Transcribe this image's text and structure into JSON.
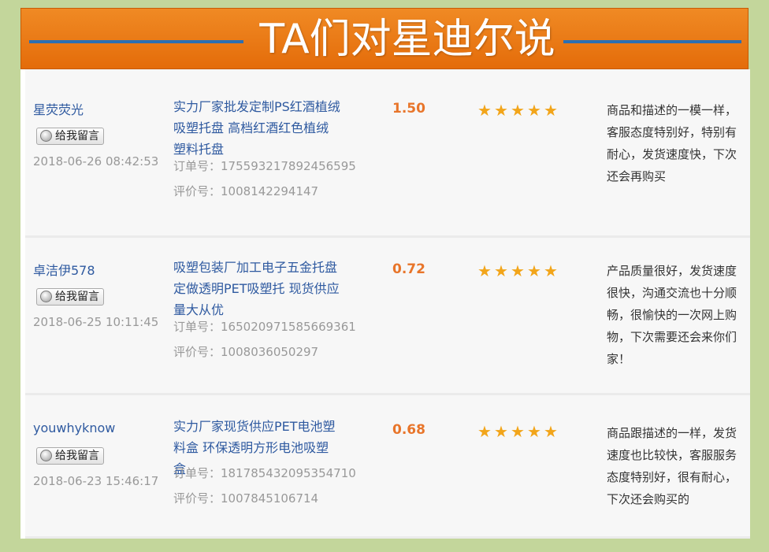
{
  "banner": {
    "title": "TA们对星迪尔说"
  },
  "colors": {
    "banner": "#e46c0a",
    "banner_line": "#2b6fb3",
    "page_bg": "#c3d69b",
    "username": "#2f5aa0",
    "price": "#e8752a",
    "star": "#f2a51a"
  },
  "message_button_label": "给我留言",
  "order_prefix": "订单号：",
  "review_prefix": "评价号：",
  "reviews": [
    {
      "user": "星荧荧光",
      "time": "2018-06-26 08:42:53",
      "product": "实力厂家批发定制PS红酒植绒吸塑托盘 高档红酒红色植绒塑料托盘",
      "order_no": "175593217892456595",
      "review_no": "1008142294147",
      "price": "1.50",
      "rating": 5,
      "comment": "商品和描述的一模一样，客服态度特别好，特别有耐心，发货速度快，下次还会再购买"
    },
    {
      "user": "卓洁伊578",
      "time": "2018-06-25 10:11:45",
      "product": "吸塑包装厂加工电子五金托盘定做透明PET吸塑托 现货供应量大从优",
      "order_no": "165020971585669361",
      "review_no": "1008036050297",
      "price": "0.72",
      "rating": 5,
      "comment": "产品质量很好，发货速度很快，沟通交流也十分顺畅，很愉快的一次网上购物，下次需要还会来你们家！"
    },
    {
      "user": "youwhyknow",
      "time": "2018-06-23 15:46:17",
      "product": "实力厂家现货供应PET电池塑料盒 环保透明方形电池吸塑盒",
      "order_no": "181785432095354710",
      "review_no": "1007845106714",
      "price": "0.68",
      "rating": 5,
      "comment": "商品跟描述的一样，发货速度也比较快，客服服务态度特别好，很有耐心，下次还会购买的"
    }
  ]
}
